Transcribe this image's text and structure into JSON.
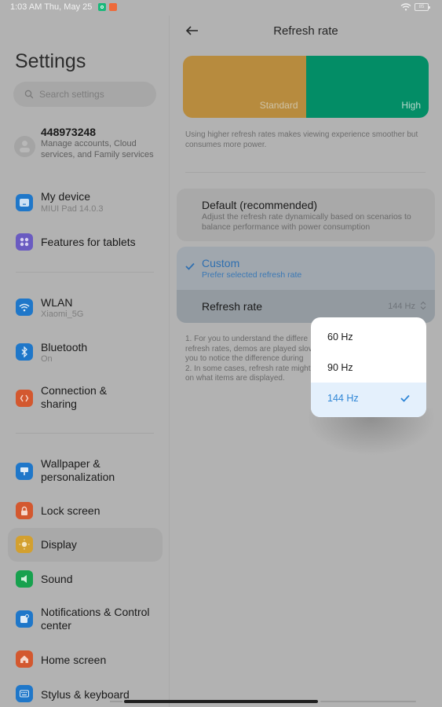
{
  "status_bar": {
    "time": "1:03 AM Thu, May 25",
    "battery": "85",
    "icons": [
      "notification-green-icon",
      "notification-orange-icon",
      "wifi-icon",
      "battery-icon"
    ]
  },
  "sidebar": {
    "title": "Settings",
    "search_placeholder": "Search settings",
    "account": {
      "name": "448973248",
      "subtitle": "Manage accounts, Cloud services, and Family services"
    },
    "items": [
      {
        "label": "My device",
        "sub": "MIUI Pad 14.0.3",
        "icon": "tablet-icon",
        "color": "#1f77c9"
      },
      {
        "label": "Features for tablets",
        "sub": "",
        "icon": "grid-icon",
        "color": "#6a5bc1"
      },
      {
        "label": "WLAN",
        "sub": "Xiaomi_5G",
        "icon": "wifi-icon",
        "color": "#1f77c9"
      },
      {
        "label": "Bluetooth",
        "sub": "On",
        "icon": "bluetooth-icon",
        "color": "#1f77c9"
      },
      {
        "label": "Connection & sharing",
        "sub": "",
        "icon": "connection-icon",
        "color": "#d3582f"
      },
      {
        "label": "Wallpaper & personalization",
        "sub": "",
        "icon": "wallpaper-icon",
        "color": "#1f77c9"
      },
      {
        "label": "Lock screen",
        "sub": "",
        "icon": "lock-icon",
        "color": "#d3582f"
      },
      {
        "label": "Display",
        "sub": "",
        "icon": "sun-icon",
        "color": "#d3a02f",
        "active": true
      },
      {
        "label": "Sound",
        "sub": "",
        "icon": "speaker-icon",
        "color": "#17a14e"
      },
      {
        "label": "Notifications & Control center",
        "sub": "",
        "icon": "notification-icon",
        "color": "#1f77c9"
      },
      {
        "label": "Home screen",
        "sub": "",
        "icon": "home-icon",
        "color": "#d3582f"
      },
      {
        "label": "Stylus & keyboard",
        "sub": "",
        "icon": "keyboard-icon",
        "color": "#1f77c9"
      }
    ]
  },
  "detail": {
    "title": "Refresh rate",
    "banner": {
      "standard": "Standard",
      "high": "High",
      "standard_color": "#b78b3e",
      "high_color": "#038d66"
    },
    "banner_desc": "Using higher refresh rates makes viewing experience smoother but consumes more power.",
    "options": {
      "default_title": "Default (recommended)",
      "default_desc": "Adjust the refresh rate dynamically based on scenarios to balance performance with power consumption",
      "custom_title": "Custom",
      "custom_desc": "Prefer selected refresh rate",
      "custom_selected": true,
      "refresh_label": "Refresh rate",
      "refresh_value": "144 Hz"
    },
    "notes": [
      "1. For you to understand the differe",
      "refresh rates, demos are played slov",
      "you to notice the difference during",
      "2. In some cases, refresh rate might",
      "on what items are displayed."
    ],
    "accent_color": "#2f86d6"
  },
  "dropdown": {
    "options": [
      "60 Hz",
      "90 Hz",
      "144 Hz"
    ],
    "selected": "144 Hz"
  }
}
